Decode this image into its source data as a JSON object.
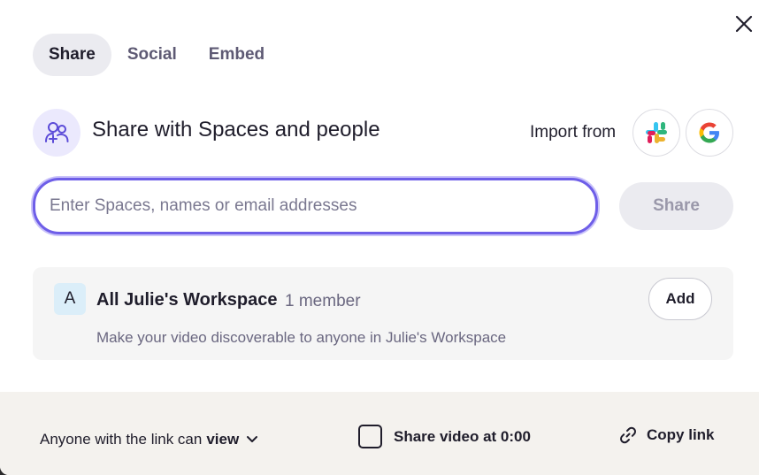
{
  "tabs": [
    {
      "label": "Share",
      "active": true
    },
    {
      "label": "Social",
      "active": false
    },
    {
      "label": "Embed",
      "active": false
    }
  ],
  "section": {
    "title": "Share with Spaces and people",
    "icon": "users-add-icon"
  },
  "import": {
    "label": "Import from",
    "sources": [
      "slack",
      "google"
    ]
  },
  "search": {
    "placeholder": "Enter Spaces, names or email addresses",
    "value": ""
  },
  "share_button": {
    "label": "Share"
  },
  "workspace": {
    "avatar_letter": "A",
    "name": "All Julie's Workspace",
    "member_count": "1 member",
    "description": "Make your video discoverable to anyone in Julie's Workspace",
    "add_label": "Add"
  },
  "footer": {
    "permission_prefix": "Anyone with the link can",
    "permission_value": "view",
    "share_at_label": "Share video at 0:00",
    "share_at_checked": false,
    "copy_link_label": "Copy link"
  },
  "colors": {
    "accent": "#6e5ee8",
    "footer_bg": "#f4f2ee"
  }
}
